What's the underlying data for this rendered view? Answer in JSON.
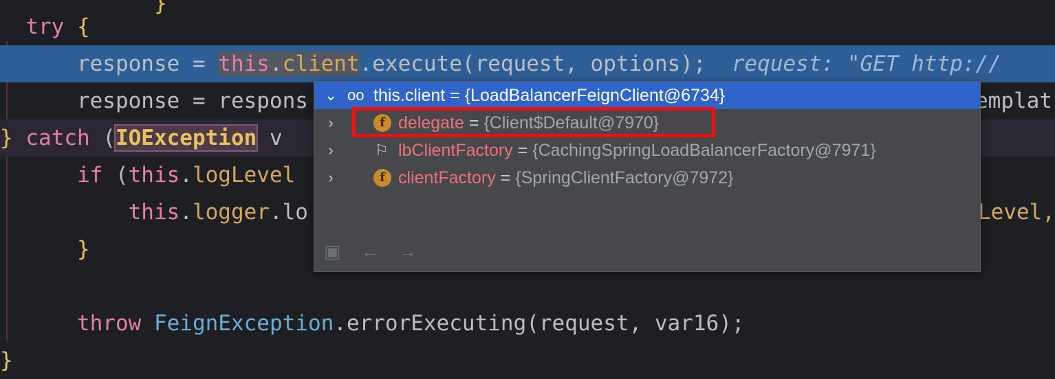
{
  "code": {
    "line0": "            }",
    "try_kw": "try",
    "try_brace": " {",
    "exec_indent": "    response = ",
    "exec_this": "this",
    "exec_dot": ".",
    "exec_client": "client",
    "exec_rest": ".execute(request, options);",
    "exec_hint": "  request: \"GET http://",
    "l3_indent": "    response = respons",
    "l3_tail": "emplat",
    "catch_close": "} ",
    "catch_kw": "catch",
    "catch_paren": " (",
    "catch_type": "IOException",
    "catch_var": " v",
    "if_indent": "    ",
    "if_kw": "if",
    "if_paren": " (",
    "if_this": "this",
    "if_dot": ".",
    "if_field": "logLevel",
    "logger_indent": "        ",
    "logger_this": "this",
    "logger_dot": ".",
    "logger_field": "logger",
    "logger_rest": ".lo",
    "logger_tail": "Level,",
    "close_if": "    }",
    "throw_indent": "    ",
    "throw_kw": "throw",
    "throw_space": " ",
    "throw_cls": "FeignException",
    "throw_rest": ".errorExecuting(request, var16);",
    "final_brace": "}"
  },
  "popup": {
    "header": {
      "expr": "this.client",
      "eq": " = ",
      "value": "{LoadBalancerFeignClient@6734}"
    },
    "rows": [
      {
        "name": "delegate",
        "eq": " = ",
        "value": "{Client$Default@7970}",
        "icon": "field-icon"
      },
      {
        "name": "lbClientFactory",
        "eq": " = ",
        "value": "{CachingSpringLoadBalancerFactory@7971}",
        "icon": "flag-icon"
      },
      {
        "name": "clientFactory",
        "eq": " = ",
        "value": "{SpringClientFactory@7972}",
        "icon": "field-icon"
      }
    ],
    "ficon_letter": "f"
  },
  "colors": {
    "editor_bg": "#1e1f22",
    "exec_line": "#2d5f96",
    "popup_header": "#2f65ca",
    "highlight_box": "#f01010"
  }
}
